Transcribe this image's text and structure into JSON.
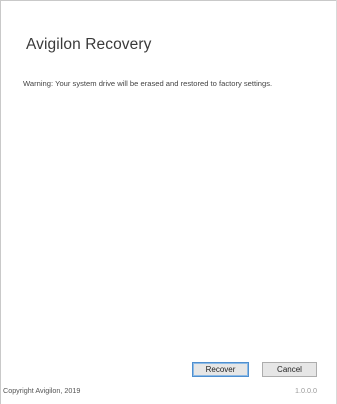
{
  "window": {
    "title": "Avigilon Recovery"
  },
  "main": {
    "warning_text": "Warning: Your system drive will be erased and restored to factory settings."
  },
  "buttons": {
    "recover_label": "Recover",
    "cancel_label": "Cancel"
  },
  "footer": {
    "copyright": "Copyright Avigilon, 2019",
    "version": "1.0.0.0"
  },
  "colors": {
    "background": "#ffffff",
    "default_button_border": "#4f8fcf",
    "button_face": "#e6e6e6"
  }
}
